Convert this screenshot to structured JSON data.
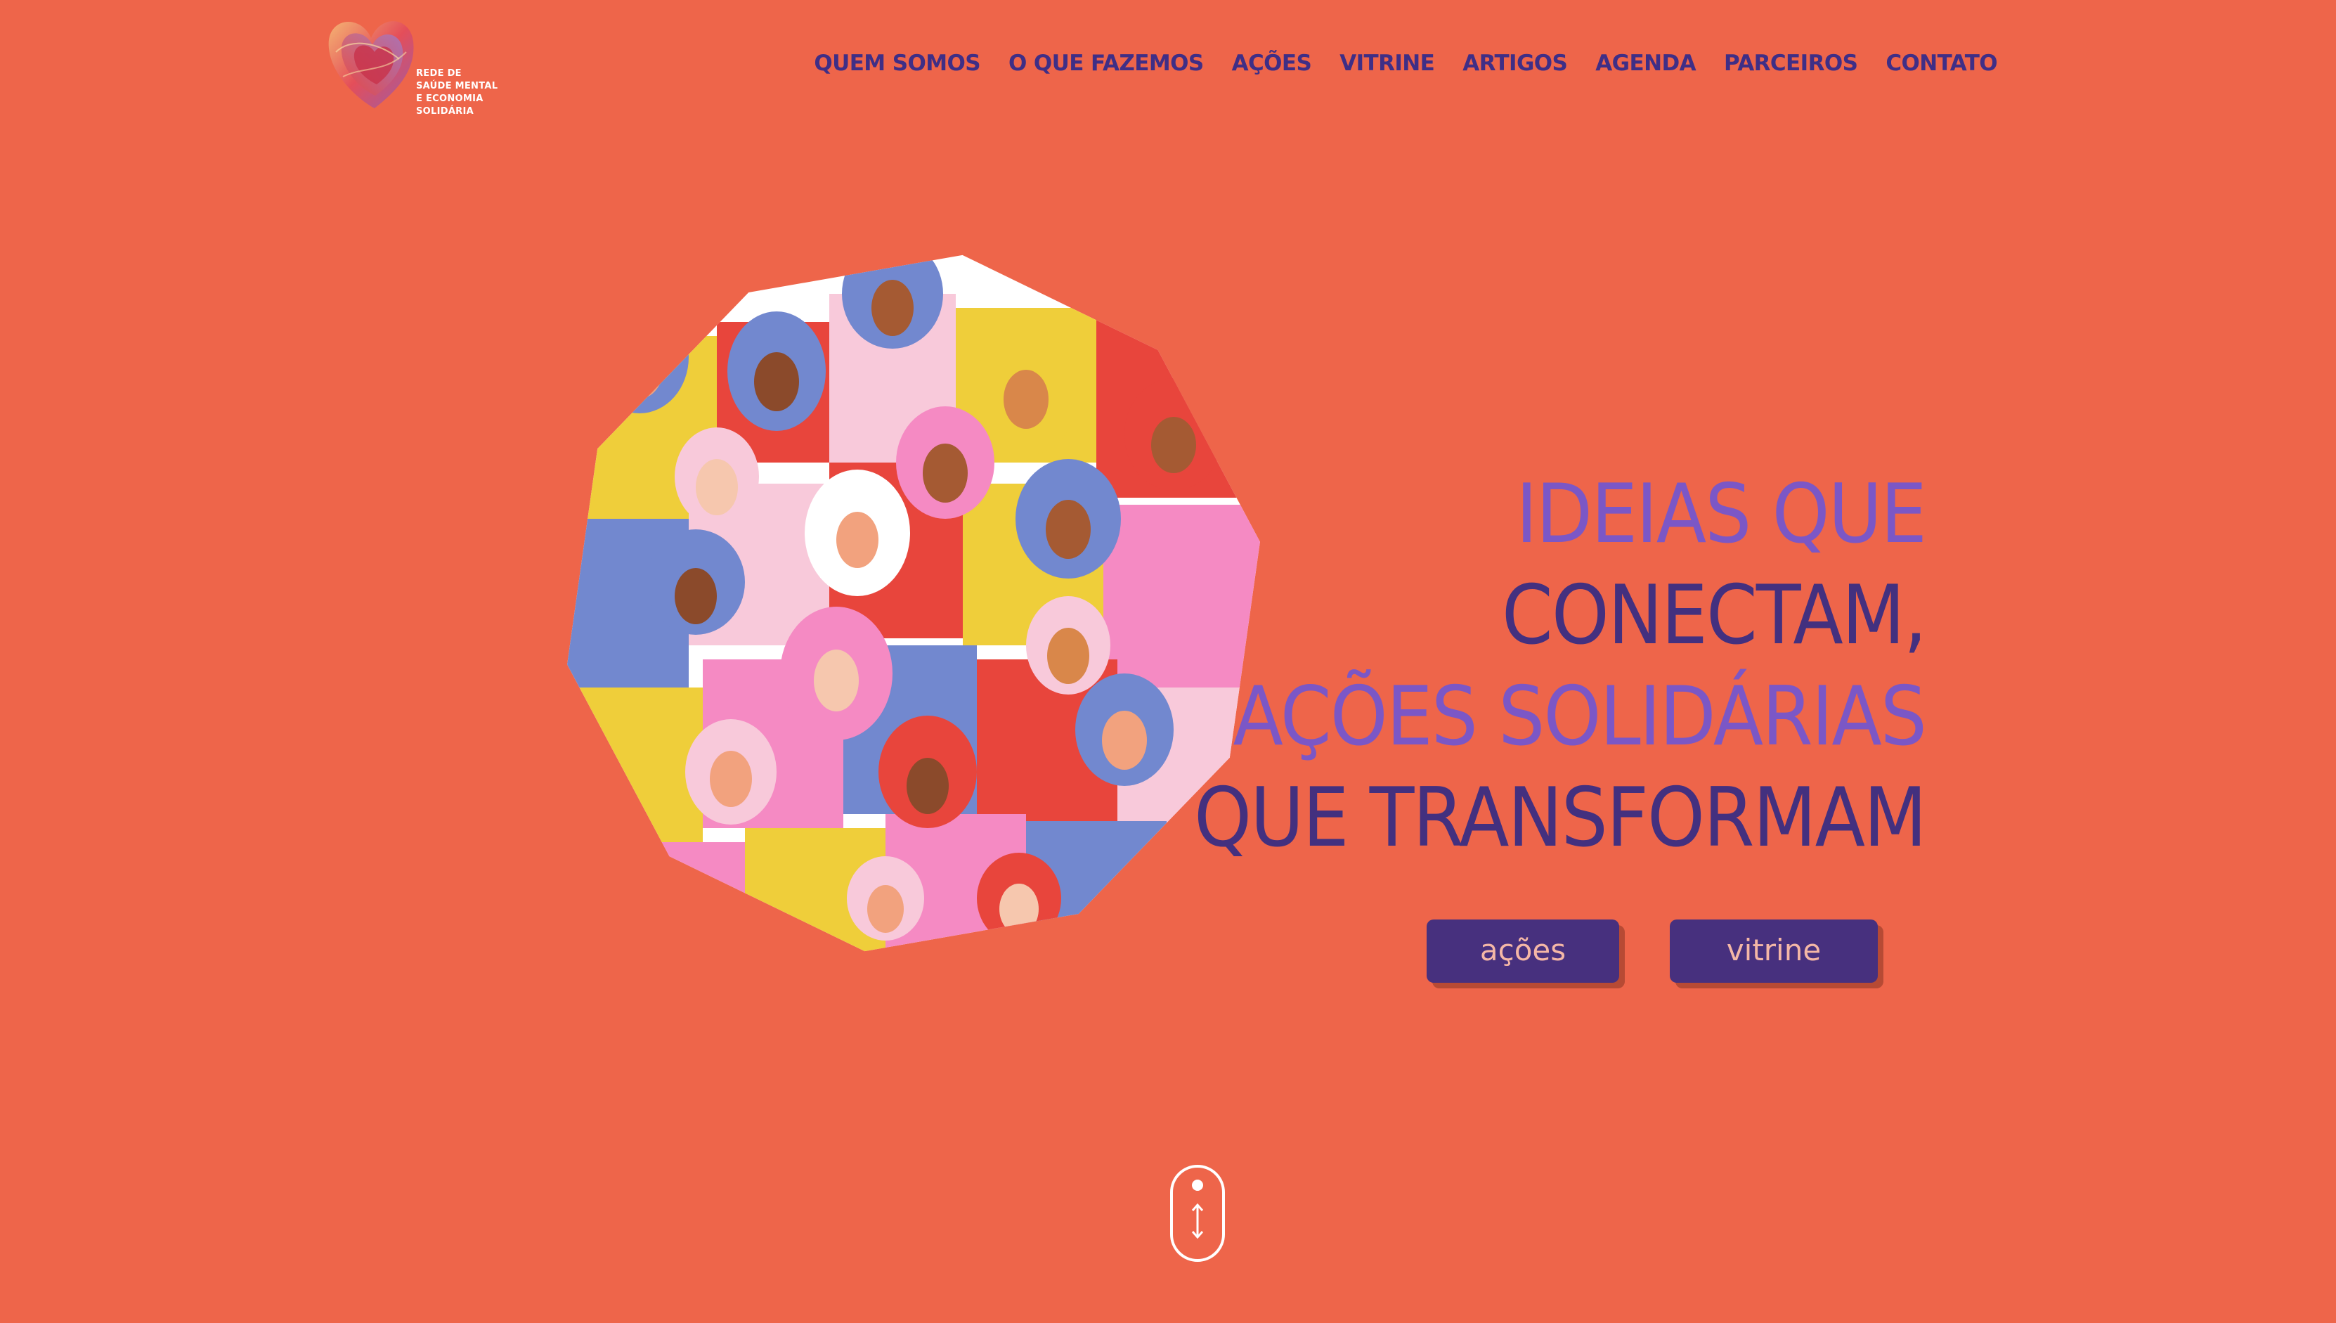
{
  "site": {
    "logo_text": [
      "REDE DE",
      "SAÚDE MENTAL",
      "E ECONOMIA",
      "SOLIDÁRIA"
    ]
  },
  "nav": {
    "items": [
      "QUEM SOMOS",
      "O QUE FAZEMOS",
      "AÇÕES",
      "VITRINE",
      "ARTIGOS",
      "AGENDA",
      "PARCEIROS",
      "CONTATO"
    ]
  },
  "hero": {
    "headline": [
      "IDEIAS QUE",
      "CONECTAM,",
      "AÇÕES SOLIDÁRIAS",
      "QUE TRANSFORMAM"
    ],
    "buttons": {
      "acoes": "ações",
      "vitrine": "vitrine"
    },
    "illustration_icon": "women-crowd-illustration"
  },
  "scroll_indicator_icon": "scroll-mouse-icon",
  "colors": {
    "background": "#EE654A",
    "primary_dark": "#43307F",
    "primary_light": "#7B57C6",
    "button_text": "#F4B7A6"
  }
}
